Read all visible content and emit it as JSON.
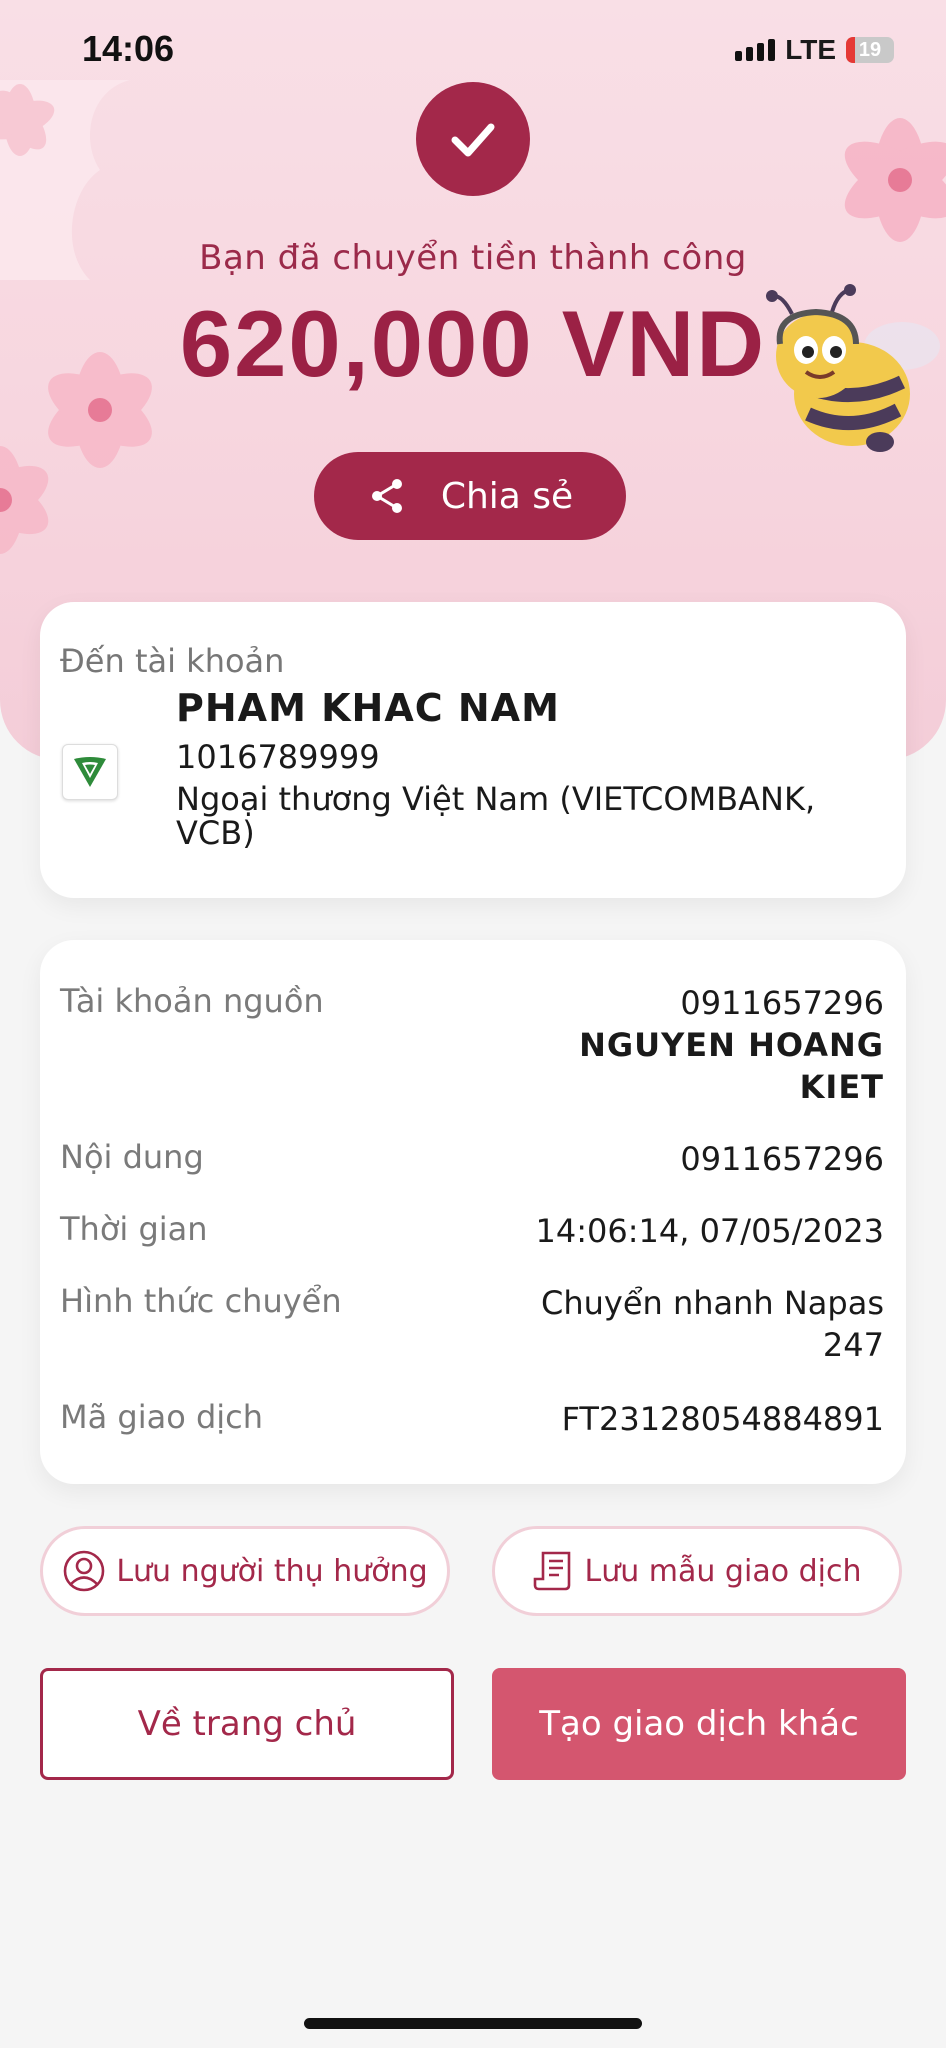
{
  "status_bar": {
    "time": "14:06",
    "network": "LTE",
    "battery": "19"
  },
  "hero": {
    "success_message": "Bạn đã chuyển tiền thành công",
    "amount": "620,000 VND",
    "share_label": "Chia sẻ"
  },
  "recipient": {
    "label": "Đến tài khoản",
    "name": "PHAM KHAC NAM",
    "account": "1016789999",
    "bank": "Ngoại thương Việt Nam (VIETCOMBANK, VCB)"
  },
  "details": {
    "source_label": "Tài khoản nguồn",
    "source_account": "0911657296",
    "source_name_line1": "NGUYEN HOANG",
    "source_name_line2": "KIET",
    "content_label": "Nội dung",
    "content_value": "0911657296",
    "time_label": "Thời gian",
    "time_value": "14:06:14, 07/05/2023",
    "method_label": "Hình thức chuyển",
    "method_value_line1": "Chuyển nhanh Napas",
    "method_value_line2": "247",
    "txn_label": "Mã giao dịch",
    "txn_value": "FT23128054884891"
  },
  "actions": {
    "save_beneficiary": "Lưu người thụ hưởng",
    "save_template": "Lưu mẫu giao dịch",
    "home": "Về trang chủ",
    "new_transaction": "Tạo giao dịch khác"
  },
  "colors": {
    "primary": "#a3284a",
    "secondary": "#d4566f",
    "hero_bg": "#f7d6df"
  },
  "icons": [
    "check-icon",
    "share-icon",
    "user-circle-icon",
    "receipt-icon",
    "vietcombank-logo-icon",
    "signal-icon",
    "battery-icon"
  ]
}
